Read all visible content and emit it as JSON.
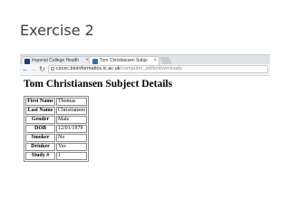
{
  "slide": {
    "title": "Exercise 2"
  },
  "browser": {
    "tabs": [
      {
        "label": "Imperial College Health",
        "active": false,
        "favicon_color": "#1a3d7c"
      },
      {
        "label": "Tom Christiansen Subje",
        "active": true,
        "favicon_color": "#2f6db3"
      }
    ],
    "close_glyph": "×",
    "url": {
      "host": "cscsc.bioinformatics.ic.ac.uk",
      "path": "/computer_skills/downloads"
    },
    "nav_icons": [
      "back-arrow-icon",
      "forward-arrow-icon",
      "reload-icon"
    ]
  },
  "page": {
    "heading": "Tom Christiansen Subject Details",
    "rows": [
      {
        "label": "First Name",
        "value": "Thomas"
      },
      {
        "label": "Last Name",
        "value": "Christiansen"
      },
      {
        "label": "Gender",
        "value": "Male"
      },
      {
        "label": "DOB",
        "value": "12/01/1979"
      },
      {
        "label": "Smoker",
        "value": "No"
      },
      {
        "label": "Drinker",
        "value": "Yes"
      },
      {
        "label": "Study #",
        "value": "1"
      }
    ]
  }
}
